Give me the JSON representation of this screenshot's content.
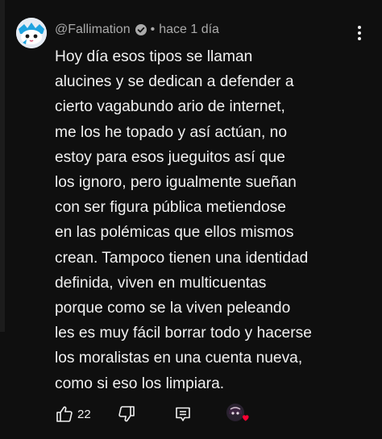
{
  "comment": {
    "author": "@Fallimation",
    "separator": "•",
    "timestamp": "hace 1 día",
    "text": "Hoy día esos tipos se llaman\nalucines y se dedican a defender a\ncierto vagabundo ario de internet,\nme los he topado y así actúan, no\nestoy para esos jueguitos así que\nlos ignoro, pero igualmente sueñan\ncon ser figura pública metiendose\nen las polémicas que ellos mismos\ncrean. Tampoco tienen una identidad\ndefinida, viven en multicuentas\nporque como se la viven peleando\nles es muy fácil borrar todo y hacerse\nlos moralistas en una cuenta nueva,\ncomo si eso los limpiara.",
    "like_count": "22"
  },
  "icons": {
    "author_avatar": "avatar-icon",
    "verified": "verified-check-icon",
    "more": "more-vertical-icon",
    "like": "thumbs-up-icon",
    "dislike": "thumbs-down-icon",
    "reply": "reply-icon",
    "creator_heart": "creator-heart-icon"
  },
  "colors": {
    "background": "#0f0f0f",
    "text": "#f1f1f1",
    "secondary_text": "#aaaaaa",
    "heart": "#ff0033"
  }
}
